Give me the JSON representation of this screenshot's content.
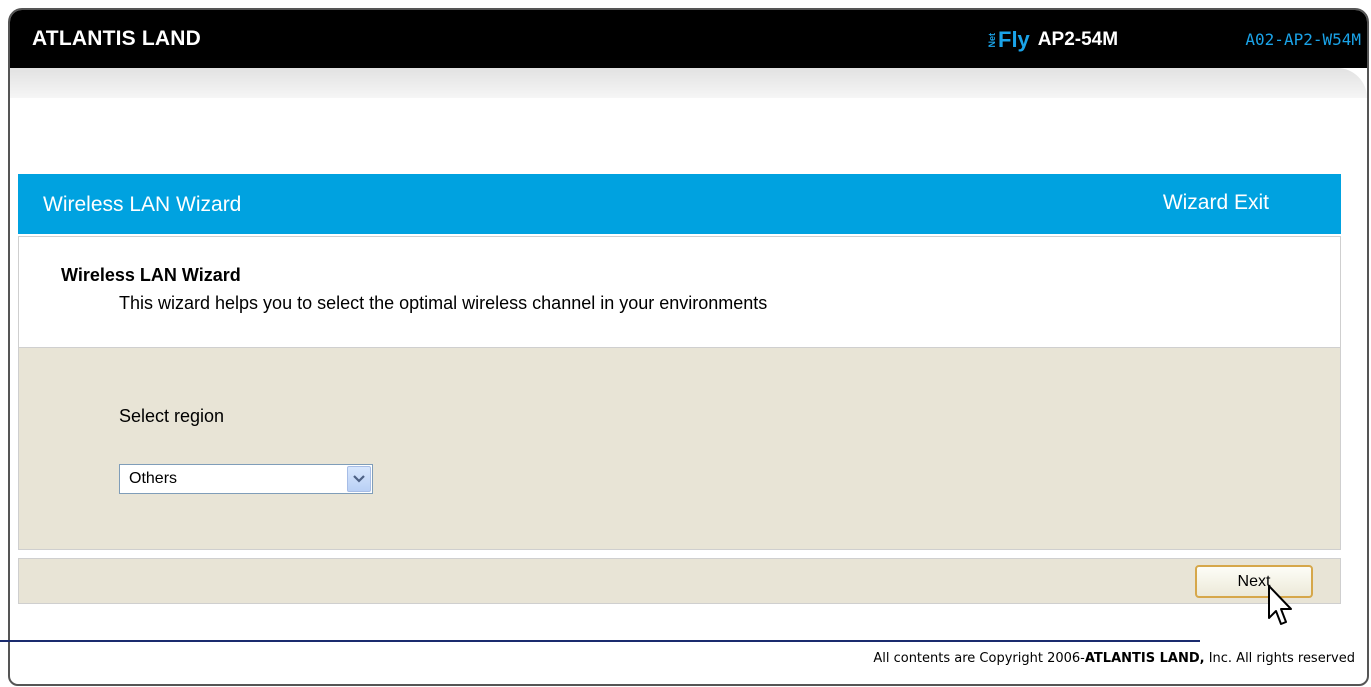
{
  "header": {
    "brand": "ATLANTIS LAND",
    "product_logo_net": "Net",
    "product_logo_fly": "Fly",
    "product_model": "AP2-54M",
    "product_code": "A02-AP2-W54M"
  },
  "wizard": {
    "title": "Wireless LAN Wizard",
    "exit_label": "Wizard Exit",
    "intro_title": "Wireless LAN Wizard",
    "intro_description": "This wizard helps you to select the optimal wireless channel in your environments",
    "region_label": "Select region",
    "region_selected": "Others",
    "next_label": "Next"
  },
  "footer": {
    "copyright_prefix": "All contents are Copyright   2006-",
    "copyright_company": "ATLANTIS LAND,",
    "copyright_suffix": " Inc. All rights reserved"
  },
  "colors": {
    "header_bg": "#000000",
    "accent_blue": "#00a2e0",
    "panel_beige": "#e8e4d6",
    "button_border": "#d6a74a",
    "rule_navy": "#1a2b6e"
  },
  "icons": {
    "dropdown": "chevron-down-icon",
    "cursor": "mouse-pointer-icon"
  }
}
